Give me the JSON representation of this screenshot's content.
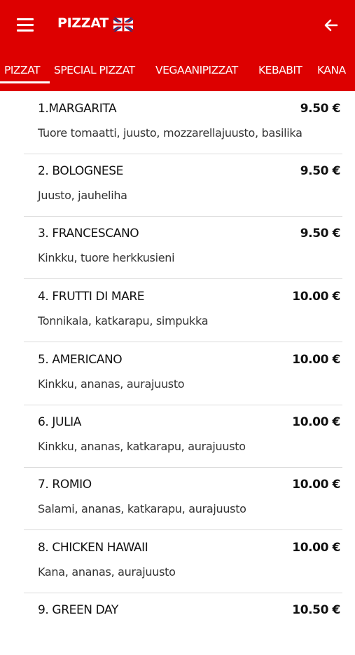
{
  "header": {
    "title": "PIZZAT",
    "menu_icon": "hamburger-menu-icon",
    "language_icon": "uk-flag-icon",
    "back_icon": "arrow-left-icon",
    "brand_color": "#dd0000"
  },
  "tabs": [
    {
      "label": "PIZZAT",
      "active": true
    },
    {
      "label": "SPECIAL PIZZAT",
      "active": false
    },
    {
      "label": "VEGAANIPIZZAT",
      "active": false
    },
    {
      "label": "KEBABIT",
      "active": false
    },
    {
      "label": "KANA",
      "active": false
    }
  ],
  "items": [
    {
      "name": "1.MARGARITA",
      "price": "9.50 €",
      "description": "Tuore tomaatti, juusto, mozzarellajuusto, basilika"
    },
    {
      "name": "2. BOLOGNESE",
      "price": "9.50 €",
      "description": "Juusto, jauheliha"
    },
    {
      "name": "3. FRANCESCANO",
      "price": "9.50 €",
      "description": "Kinkku, tuore herkkusieni"
    },
    {
      "name": "4. FRUTTI DI MARE",
      "price": "10.00 €",
      "description": "Tonnikala, katkarapu, simpukka"
    },
    {
      "name": "5. AMERICANO",
      "price": "10.00 €",
      "description": "Kinkku, ananas, aurajuusto"
    },
    {
      "name": "6. JULIA",
      "price": "10.00 €",
      "description": "Kinkku, ananas, katkarapu, aurajuusto"
    },
    {
      "name": "7. ROMIO",
      "price": "10.00 €",
      "description": "Salami, ananas, katkarapu, aurajuusto"
    },
    {
      "name": "8. CHICKEN HAWAII",
      "price": "10.00 €",
      "description": "Kana, ananas, aurajuusto"
    },
    {
      "name": "9. GREEN DAY",
      "price": "10.50 €",
      "description": ""
    }
  ]
}
